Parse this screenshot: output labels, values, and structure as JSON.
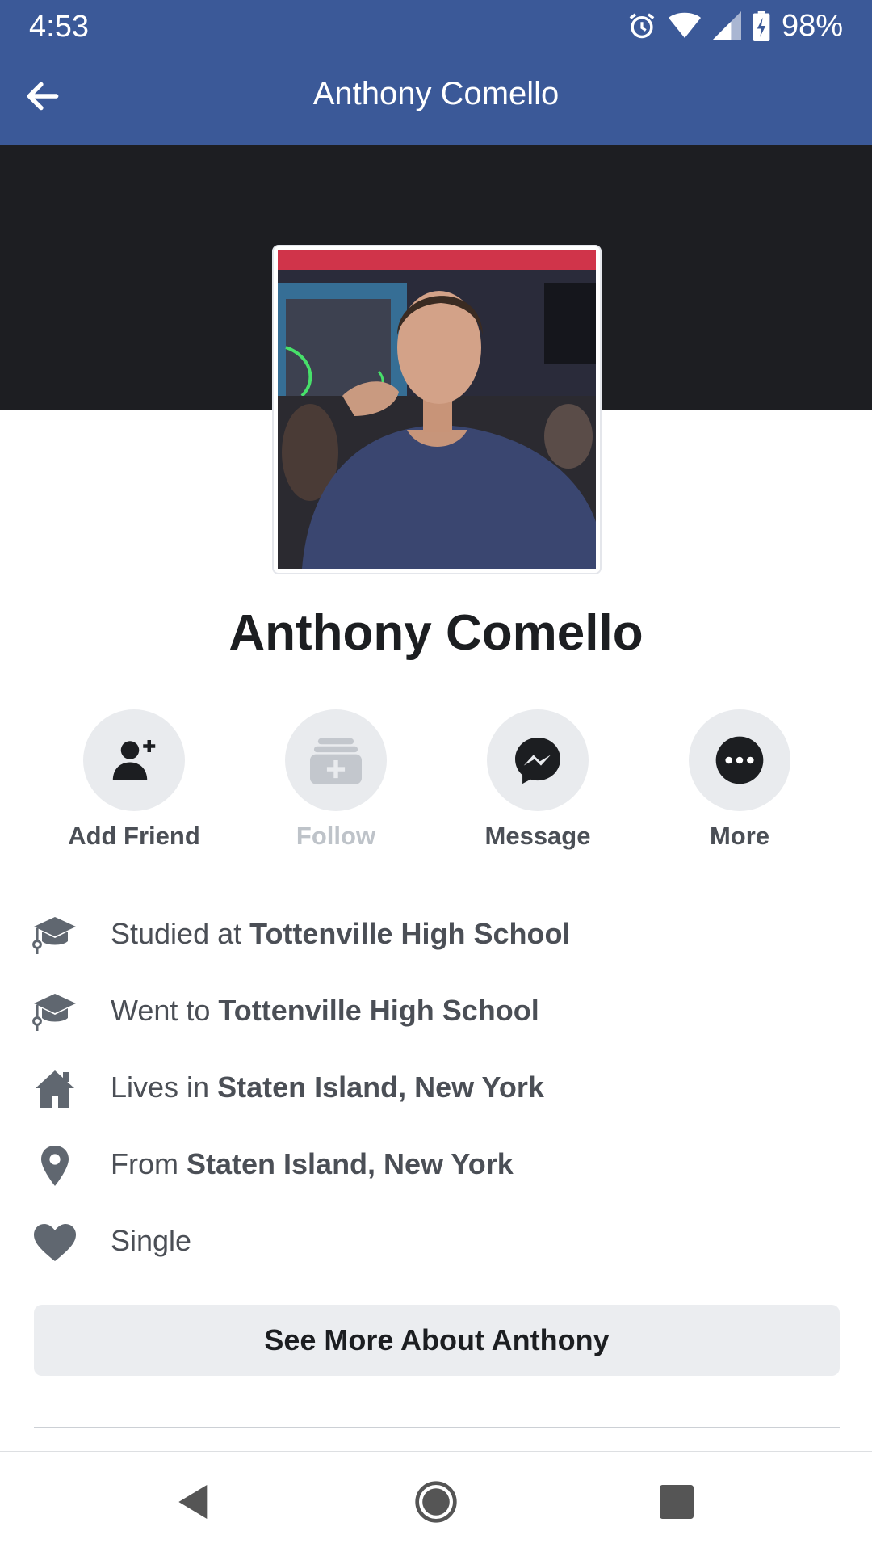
{
  "status_bar": {
    "time": "4:53",
    "battery": "98%"
  },
  "app_bar": {
    "title": "Anthony Comello"
  },
  "profile": {
    "name": "Anthony Comello"
  },
  "actions": {
    "add_friend": "Add Friend",
    "follow": "Follow",
    "message": "Message",
    "more": "More"
  },
  "details": [
    {
      "prefix": "Studied at ",
      "value": "Tottenville High School",
      "icon": "graduation-cap-icon"
    },
    {
      "prefix": "Went to ",
      "value": "Tottenville High School",
      "icon": "graduation-cap-icon"
    },
    {
      "prefix": "Lives in ",
      "value": "Staten Island, New York",
      "icon": "home-icon"
    },
    {
      "prefix": "From ",
      "value": "Staten Island, New York",
      "icon": "location-pin-icon"
    },
    {
      "prefix": "Single",
      "value": "",
      "icon": "heart-icon"
    }
  ],
  "see_more": "See More About Anthony",
  "colors": {
    "brand": "#3b5998",
    "cover": "#1d1e22",
    "icon_gray": "#606770"
  }
}
